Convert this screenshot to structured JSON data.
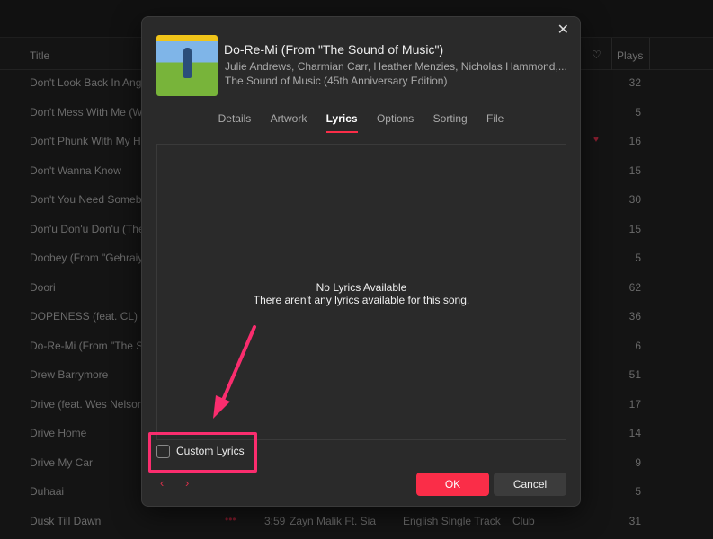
{
  "table": {
    "headers": {
      "title": "Title",
      "plays": "Plays"
    },
    "rows": [
      {
        "title": "Don't Look Back In Ange",
        "plays": "32"
      },
      {
        "title": "Don't Mess With Me (Wh",
        "plays": "5"
      },
      {
        "title": "Don't Phunk With My He",
        "plays": "16",
        "loved": true
      },
      {
        "title": "Don't Wanna Know",
        "plays": "15"
      },
      {
        "title": "Don't You Need Somebo",
        "plays": "30"
      },
      {
        "title": "Don'u Don'u Don'u (The",
        "plays": "15"
      },
      {
        "title": "Doobey (From \"Gehraiya",
        "plays": "5"
      },
      {
        "title": "Doori",
        "plays": "62"
      },
      {
        "title": "DOPENESS (feat. CL)",
        "plays": "36"
      },
      {
        "title": "Do-Re-Mi (From \"The So",
        "plays": "6"
      },
      {
        "title": "Drew Barrymore",
        "plays": "51"
      },
      {
        "title": "Drive (feat. Wes Nelson)",
        "plays": "17"
      },
      {
        "title": "Drive Home",
        "plays": "14"
      },
      {
        "title": "Drive My Car",
        "plays": "9"
      },
      {
        "title": "Duhaai",
        "plays": "5"
      },
      {
        "title": "Dusk Till Dawn",
        "plays": "31",
        "time": "3:59",
        "artist": "Zayn Malik Ft. Sia",
        "album": "English Single Track",
        "genre": "Club"
      }
    ]
  },
  "dialog": {
    "song_title": "Do-Re-Mi (From \"The Sound of Music\")",
    "artists": "Julie Andrews, Charmian Carr, Heather Menzies, Nicholas Hammond,...",
    "album": "The Sound of Music (45th Anniversary Edition)",
    "tabs": [
      "Details",
      "Artwork",
      "Lyrics",
      "Options",
      "Sorting",
      "File"
    ],
    "active_tab": "Lyrics",
    "no_lyrics_title": "No Lyrics Available",
    "no_lyrics_message": "There aren't any lyrics available for this song.",
    "custom_lyrics_label": "Custom Lyrics",
    "custom_lyrics_checked": false,
    "ok_label": "OK",
    "cancel_label": "Cancel"
  },
  "colors": {
    "accent": "#fa2d48",
    "annotation": "#fa2d6e"
  }
}
